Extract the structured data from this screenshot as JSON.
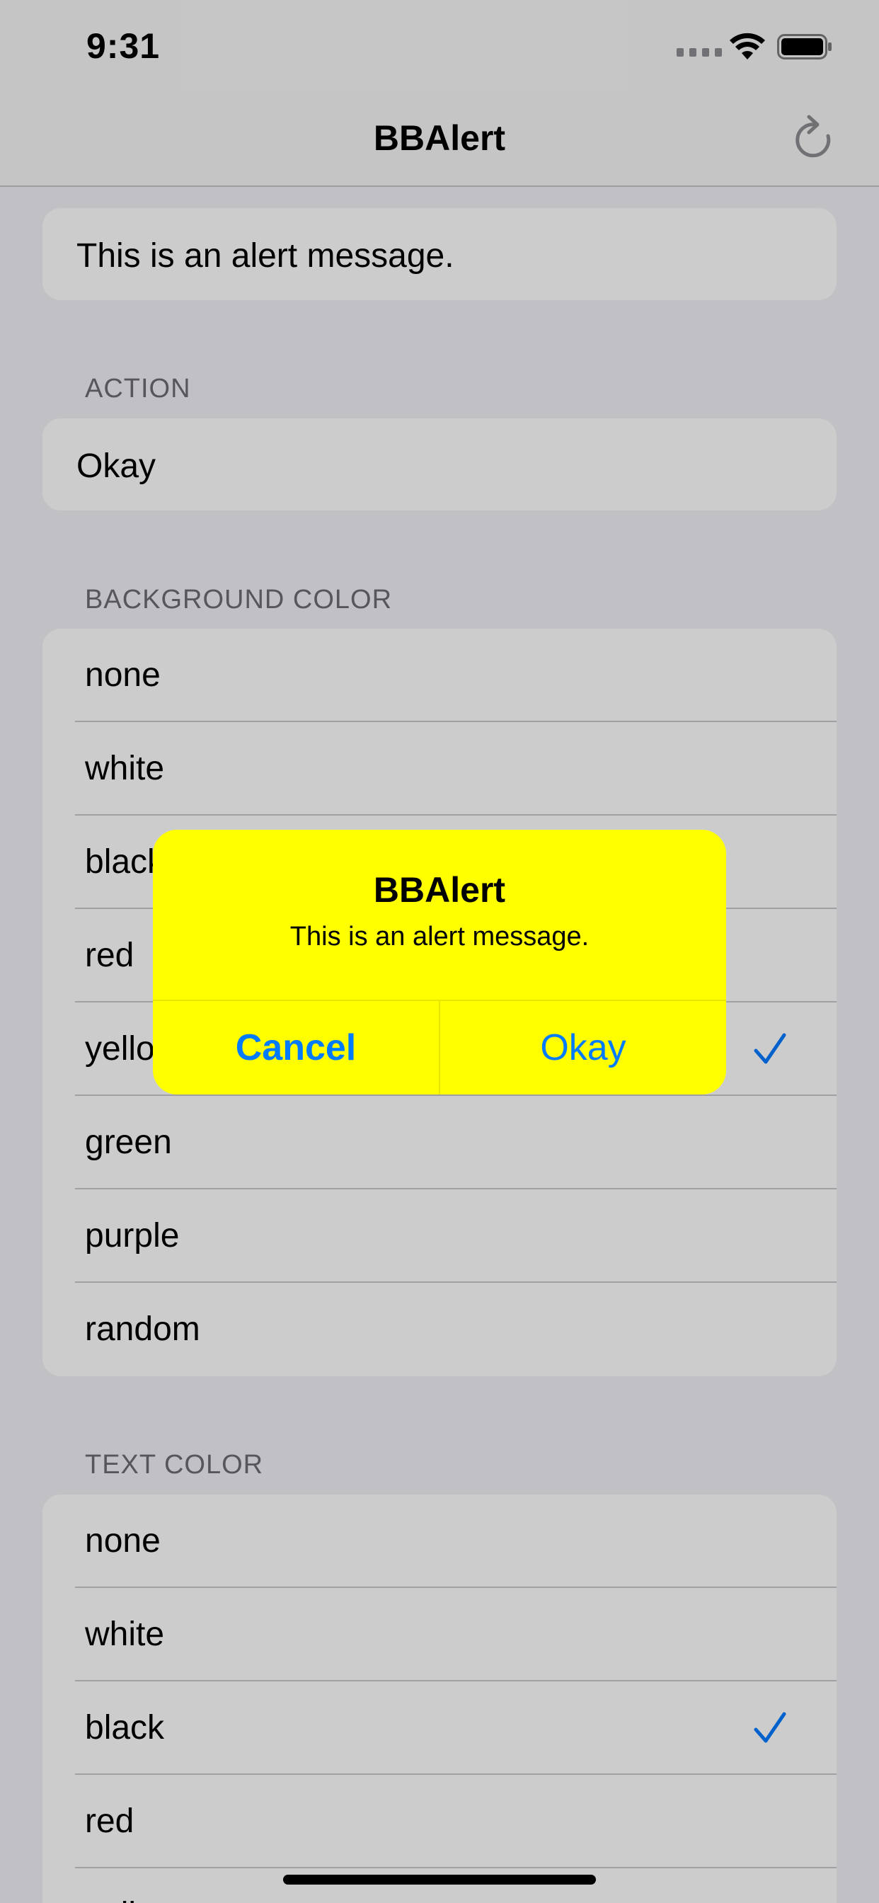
{
  "status_bar": {
    "time": "9:31"
  },
  "nav": {
    "title": "BBAlert"
  },
  "message_field": {
    "value": "This is an alert message."
  },
  "action_section": {
    "header": "ACTION",
    "value": "Okay"
  },
  "background_color_section": {
    "header": "BACKGROUND COLOR",
    "options": [
      "none",
      "white",
      "black",
      "red",
      "yellow",
      "green",
      "purple",
      "random"
    ],
    "selected": "yellow"
  },
  "text_color_section": {
    "header": "TEXT COLOR",
    "options": [
      "none",
      "white",
      "black",
      "red",
      "yellow"
    ],
    "selected": "black"
  },
  "alert": {
    "title": "BBAlert",
    "message": "This is an alert message.",
    "cancel_label": "Cancel",
    "okay_label": "Okay",
    "background": "#ffff00",
    "button_color": "#007aff"
  },
  "icons": [
    "signal-icon",
    "wifi-icon",
    "battery-icon",
    "refresh-icon",
    "checkmark-icon"
  ]
}
